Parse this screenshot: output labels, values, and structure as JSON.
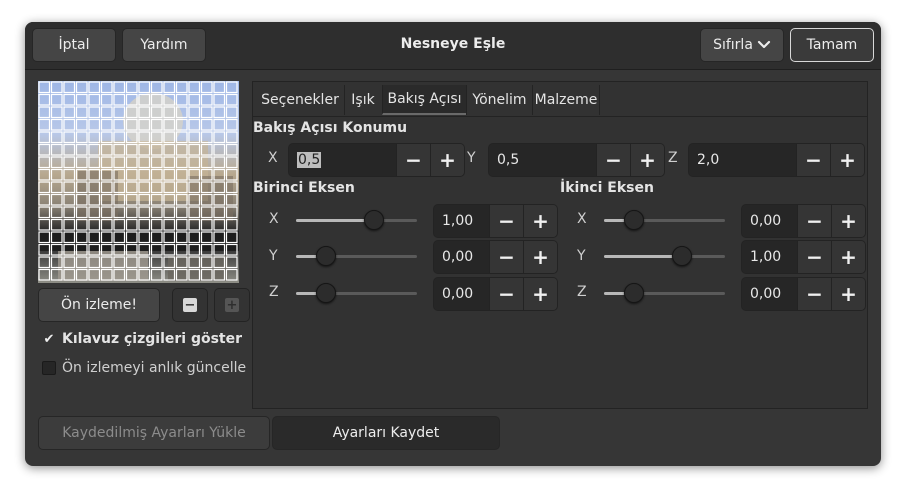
{
  "header": {
    "cancel_label": "İptal",
    "help_label": "Yardım",
    "title": "Nesneye Eşle",
    "reset_label": "Sıfırla",
    "ok_label": "Tamam"
  },
  "preview": {
    "button_label": "Ön izleme!",
    "zoom_out_icon": "minus-icon",
    "zoom_in_icon": "plus-icon",
    "show_guides_label": "Kılavuz çizgileri göster",
    "show_guides_checked": true,
    "instant_update_label": "Ön izlemeyi anlık güncelle",
    "instant_update_checked": false
  },
  "tabs": [
    {
      "label": "Seçenekler"
    },
    {
      "label": "Işık"
    },
    {
      "label": "Bakış Açısı",
      "active": true
    },
    {
      "label": "Yönelim"
    },
    {
      "label": "Malzeme"
    }
  ],
  "viewpoint": {
    "title": "Bakış Açısı Konumu",
    "fields": [
      {
        "axis": "X",
        "value": "0,5"
      },
      {
        "axis": "Y",
        "value": "0,5"
      },
      {
        "axis": "Z",
        "value": "2,0"
      }
    ]
  },
  "first_axis": {
    "title": "Birinci Eksen",
    "rows": [
      {
        "axis": "X",
        "value": "1,00",
        "level": 1.0
      },
      {
        "axis": "Y",
        "value": "0,00",
        "level": 0.0
      },
      {
        "axis": "Z",
        "value": "0,00",
        "level": 0.0
      }
    ]
  },
  "second_axis": {
    "title": "İkinci Eksen",
    "rows": [
      {
        "axis": "X",
        "value": "0,00",
        "level": 0.0
      },
      {
        "axis": "Y",
        "value": "1,00",
        "level": 1.0
      },
      {
        "axis": "Z",
        "value": "0,00",
        "level": 0.0
      }
    ]
  },
  "footer": {
    "load_label": "Kaydedilmiş Ayarları Yükle",
    "save_label": "Ayarları Kaydet"
  },
  "colors": {
    "dialog_bg": "#363636",
    "header_bg": "#2e2e2e",
    "slider_fill": "#b8b8b8"
  }
}
